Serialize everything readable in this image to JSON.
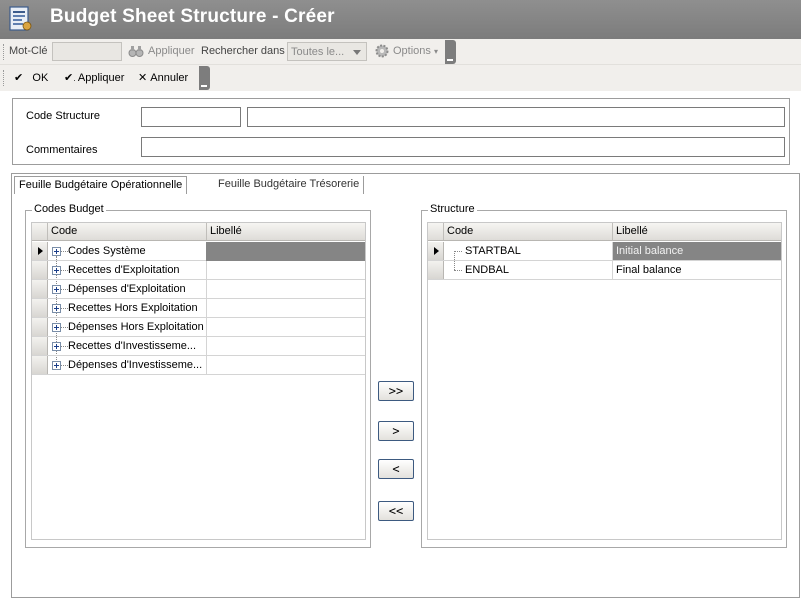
{
  "window": {
    "title": "Budget Sheet Structure - Créer",
    "icon": "document-form-icon"
  },
  "search_toolbar": {
    "keyword_label": "Mot-Clé",
    "keyword_value": "",
    "apply_label": "Appliquer",
    "search_in_label": "Rechercher dans",
    "search_in_value": "Toutes le...",
    "options_label": "Options"
  },
  "action_toolbar": {
    "ok_label": "OK",
    "apply_label": "Appliquer",
    "cancel_label": "Annuler"
  },
  "header_form": {
    "code_label": "Code Structure",
    "code_value": "",
    "description_value": "",
    "comments_label": "Commentaires",
    "comments_value": ""
  },
  "tabs": [
    {
      "label": "Feuille Budgétaire Opérationnelle",
      "active": true
    },
    {
      "label": "Feuille Budgétaire Trésorerie",
      "active": false
    }
  ],
  "codes_budget": {
    "title": "Codes Budget",
    "columns": [
      "Code",
      "Libellé"
    ],
    "rows": [
      {
        "code": "Codes Système",
        "libelle": ""
      },
      {
        "code": "Recettes d'Exploitation",
        "libelle": ""
      },
      {
        "code": "Dépenses d'Exploitation",
        "libelle": ""
      },
      {
        "code": "Recettes Hors Exploitation",
        "libelle": ""
      },
      {
        "code": "Dépenses Hors Exploitation",
        "libelle": ""
      },
      {
        "code": "Recettes d'Investisseme...",
        "libelle": ""
      },
      {
        "code": "Dépenses d'Investisseme...",
        "libelle": ""
      }
    ]
  },
  "transfer_buttons": {
    "add_all": ">>",
    "add": ">",
    "remove": "<",
    "remove_all": "<<"
  },
  "structure": {
    "title": "Structure",
    "columns": [
      "Code",
      "Libellé"
    ],
    "rows": [
      {
        "code": "STARTBAL",
        "libelle": "Initial balance"
      },
      {
        "code": "ENDBAL",
        "libelle": "Final balance"
      }
    ]
  },
  "colors": {
    "titlebar": "#7f7f7f",
    "toolbar": "#f1efec",
    "selected_cell": "#858585"
  }
}
